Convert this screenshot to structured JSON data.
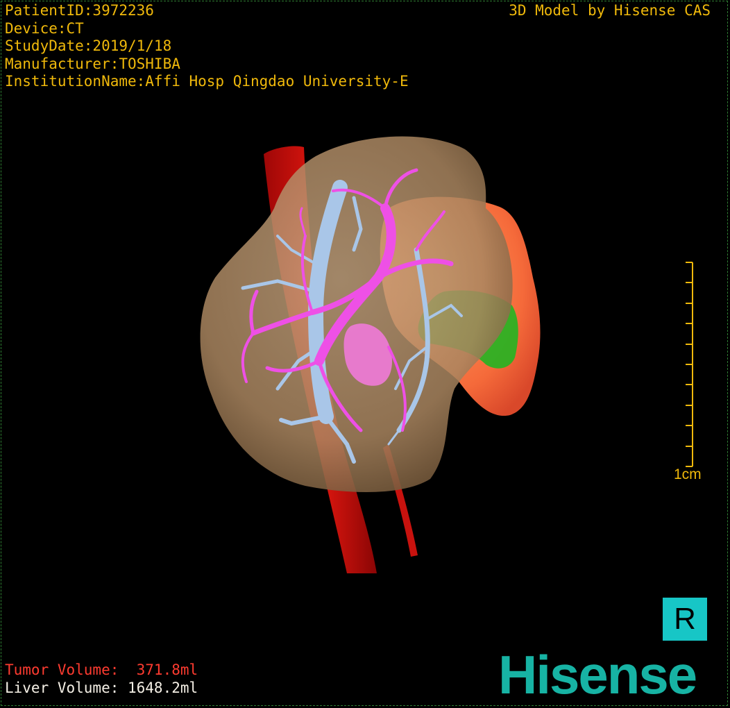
{
  "header": {
    "patient_id": "PatientID:3972236",
    "device": "Device:CT",
    "study_date": "StudyDate:2019/1/18",
    "manufacturer": "Manufacturer:TOSHIBA",
    "institution": "InstitutionName:Affi Hosp Qingdao University-E"
  },
  "credit": "3D Model by Hisense CAS",
  "scale_bar": {
    "label": "1cm"
  },
  "orientation": {
    "label": "R"
  },
  "volumes": {
    "tumor": "Tumor Volume:  371.8ml",
    "liver": "Liver Volume: 1648.2ml"
  },
  "logo": "Hisense",
  "colors": {
    "text": "#f0b90b",
    "tumor_text": "#ff3b30",
    "liver_tissue": "#c8a27a",
    "aorta": "#d10f0f",
    "portal_vein": "#ee50e6",
    "hepatic_vein": "#a9c6e8",
    "tumor": "#ff7a45",
    "gallbladder": "#22b522",
    "orientation_box": "#17c6c6",
    "brand": "#17b3a4"
  }
}
